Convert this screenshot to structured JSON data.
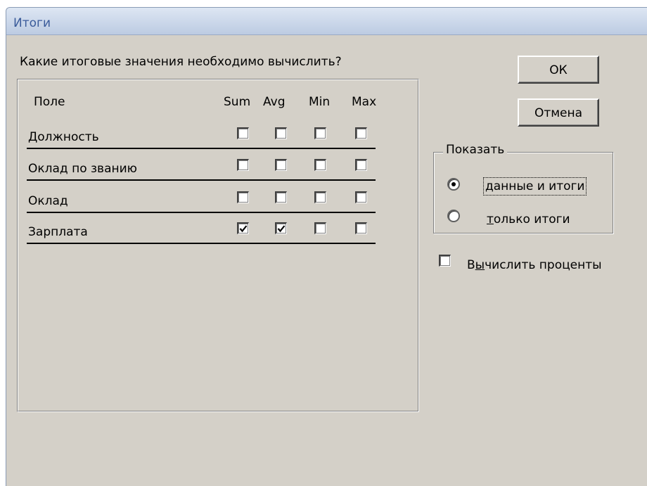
{
  "window": {
    "title": "Итоги"
  },
  "question": "Какие итоговые значения необходимо вычислить?",
  "table": {
    "field_header": "Поле",
    "columns": [
      "Sum",
      "Avg",
      "Min",
      "Max"
    ],
    "rows": [
      {
        "label": "Должность",
        "checks": [
          false,
          false,
          false,
          false
        ]
      },
      {
        "label": "Оклад по званию",
        "checks": [
          false,
          false,
          false,
          false
        ]
      },
      {
        "label": "Оклад",
        "checks": [
          false,
          false,
          false,
          false
        ]
      },
      {
        "label": "Зарплата",
        "checks": [
          true,
          true,
          false,
          false
        ]
      }
    ]
  },
  "buttons": {
    "ok": "ОК",
    "cancel": "Отмена"
  },
  "show_group": {
    "label": "Показать",
    "options": [
      {
        "pre": "",
        "underline": "д",
        "post": "анные и итоги",
        "selected": true
      },
      {
        "pre": "",
        "underline": "т",
        "post": "олько итоги",
        "selected": false
      }
    ]
  },
  "percent": {
    "pre": "В",
    "underline": "ы",
    "post": "числить проценты",
    "checked": false
  }
}
